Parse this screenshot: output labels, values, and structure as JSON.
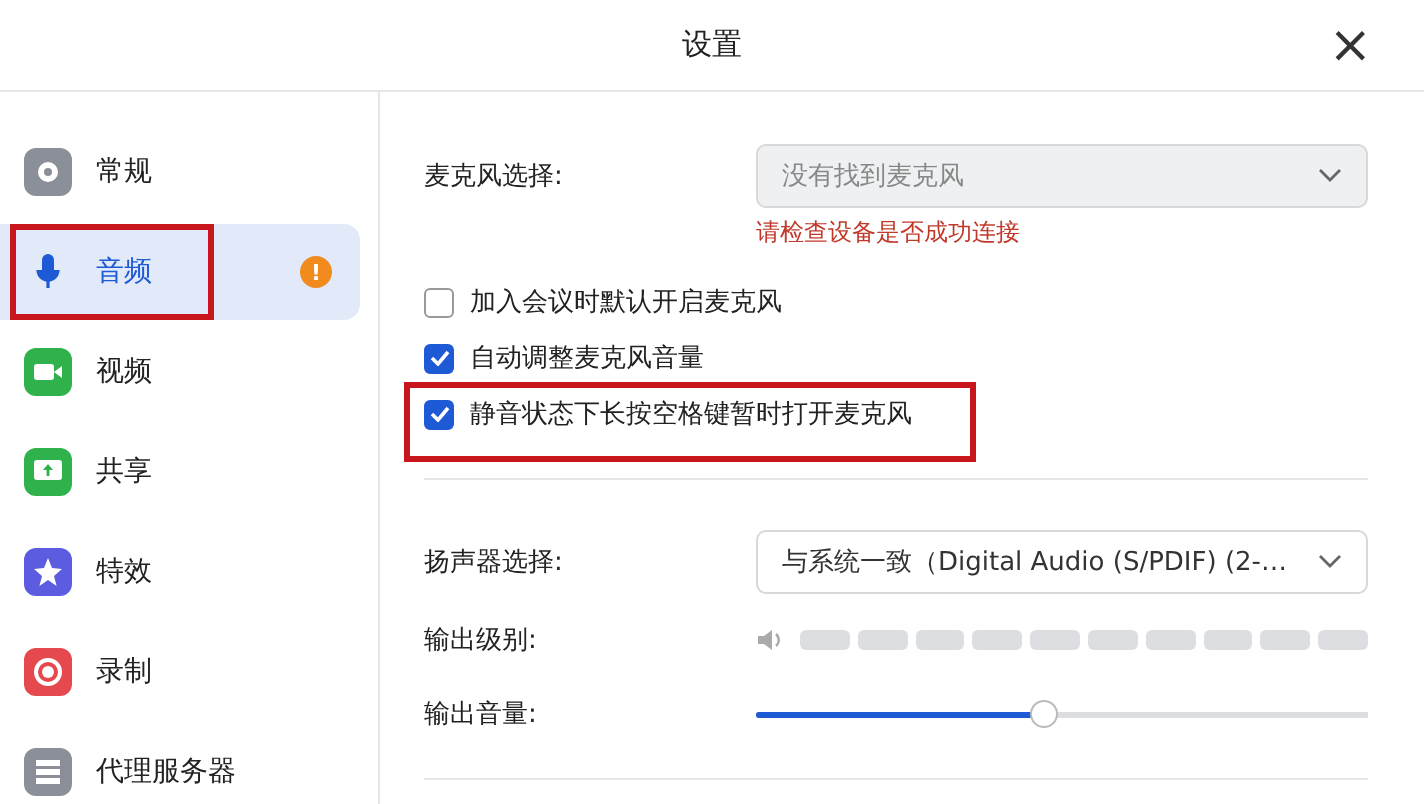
{
  "window": {
    "title": "设置",
    "close": "×"
  },
  "sidebar": {
    "items": [
      {
        "label": "常规",
        "selected": false,
        "highlighted": false,
        "color": "#8a8f98"
      },
      {
        "label": "音频",
        "selected": true,
        "highlighted": true,
        "badge": "!",
        "color": "#1f5ad6"
      },
      {
        "label": "视频",
        "selected": false,
        "highlighted": false,
        "color": "#2fb24c"
      },
      {
        "label": "共享",
        "selected": false,
        "highlighted": false,
        "color": "#2fb24c"
      },
      {
        "label": "特效",
        "selected": false,
        "highlighted": false,
        "color": "#5b5ce0"
      },
      {
        "label": "录制",
        "selected": false,
        "highlighted": false,
        "color": "#e5484d"
      },
      {
        "label": "代理服务器",
        "selected": false,
        "highlighted": false,
        "color": "#8a8f98"
      }
    ]
  },
  "microphone": {
    "label": "麦克风选择:",
    "value": "没有找到麦克风",
    "disabled": true,
    "error": "请检查设备是否成功连接"
  },
  "options": [
    {
      "label": "加入会议时默认开启麦克风",
      "checked": false
    },
    {
      "label": "自动调整麦克风音量",
      "checked": true
    },
    {
      "label": "静音状态下长按空格键暂时打开麦克风",
      "checked": true,
      "highlighted": true
    }
  ],
  "speaker": {
    "label": "扬声器选择:",
    "value": "与系统一致（Digital Audio (S/PDIF) (2-…",
    "disabled": false
  },
  "output_level": {
    "label": "输出级别:"
  },
  "output_volume": {
    "label": "输出音量:",
    "level": 0.47
  }
}
